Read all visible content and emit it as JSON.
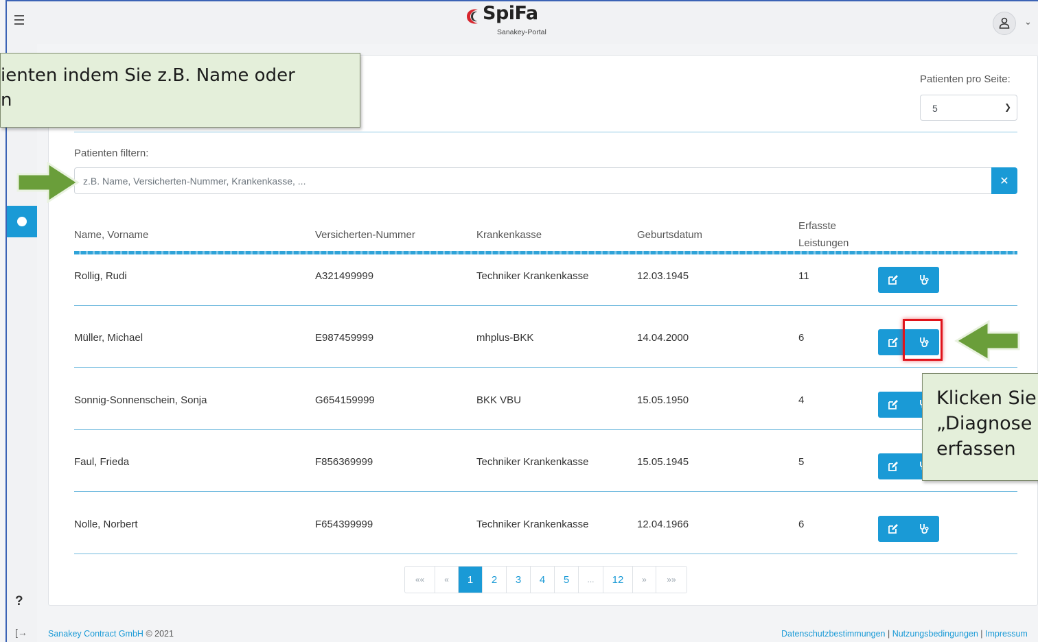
{
  "header": {
    "logo_text": "SpiFa",
    "logo_subtitle": "Sanakey-Portal"
  },
  "colors": {
    "primary": "#1a9ad6",
    "highlight": "#e0131b",
    "callout_bg": "#e4efda",
    "arrow": "#6a9e3a"
  },
  "page_size": {
    "label": "Patienten pro Seite:",
    "selected": "5"
  },
  "filter": {
    "label": "Patienten filtern:",
    "placeholder": "z.B. Name, Versicherten-Nummer, Krankenkasse, ...",
    "value": ""
  },
  "table": {
    "headers": [
      "Name, Vorname",
      "Versicherten-Nummer",
      "Krankenkasse",
      "Geburtsdatum",
      "Erfasste",
      "Leistungen"
    ],
    "rows": [
      {
        "name": "Rollig, Rudi",
        "number": "A321499999",
        "insurance": "Techniker Krankenkasse",
        "birth": "12.03.1945",
        "count": "11"
      },
      {
        "name": "Müller, Michael",
        "number": "E987459999",
        "insurance": "mhplus-BKK",
        "birth": "14.04.2000",
        "count": "6"
      },
      {
        "name": "Sonnig-Sonnenschein, Sonja",
        "number": "G654159999",
        "insurance": "BKK VBU",
        "birth": "15.05.1950",
        "count": "4"
      },
      {
        "name": "Faul, Frieda",
        "number": "F856369999",
        "insurance": "Techniker Krankenkasse",
        "birth": "15.05.1945",
        "count": "5"
      },
      {
        "name": "Nolle, Norbert",
        "number": "F654399999",
        "insurance": "Techniker Krankenkasse",
        "birth": "12.04.1966",
        "count": "6"
      }
    ],
    "row_icons": [
      "edit-icon",
      "stethoscope-icon"
    ]
  },
  "pagination": {
    "first": "««",
    "prev": "«",
    "pages": [
      "1",
      "2",
      "3",
      "4",
      "5",
      "...",
      "12"
    ],
    "current": "1",
    "next": "»",
    "last": "»»"
  },
  "sidebar": {
    "help": "?",
    "logout": "[→"
  },
  "footer": {
    "company": "Sanakey Contract GmbH",
    "copyright": "© 2021",
    "privacy": "Datenschutzbestimmungen",
    "separator": "|",
    "terms": "Nutzungsbedingungen",
    "imprint": "Impressum"
  },
  "callouts": {
    "top": [
      "ienten indem Sie z.B. Name oder",
      "n"
    ],
    "right": [
      "Klicken Sie",
      "„Diagnose",
      "erfassen"
    ]
  }
}
